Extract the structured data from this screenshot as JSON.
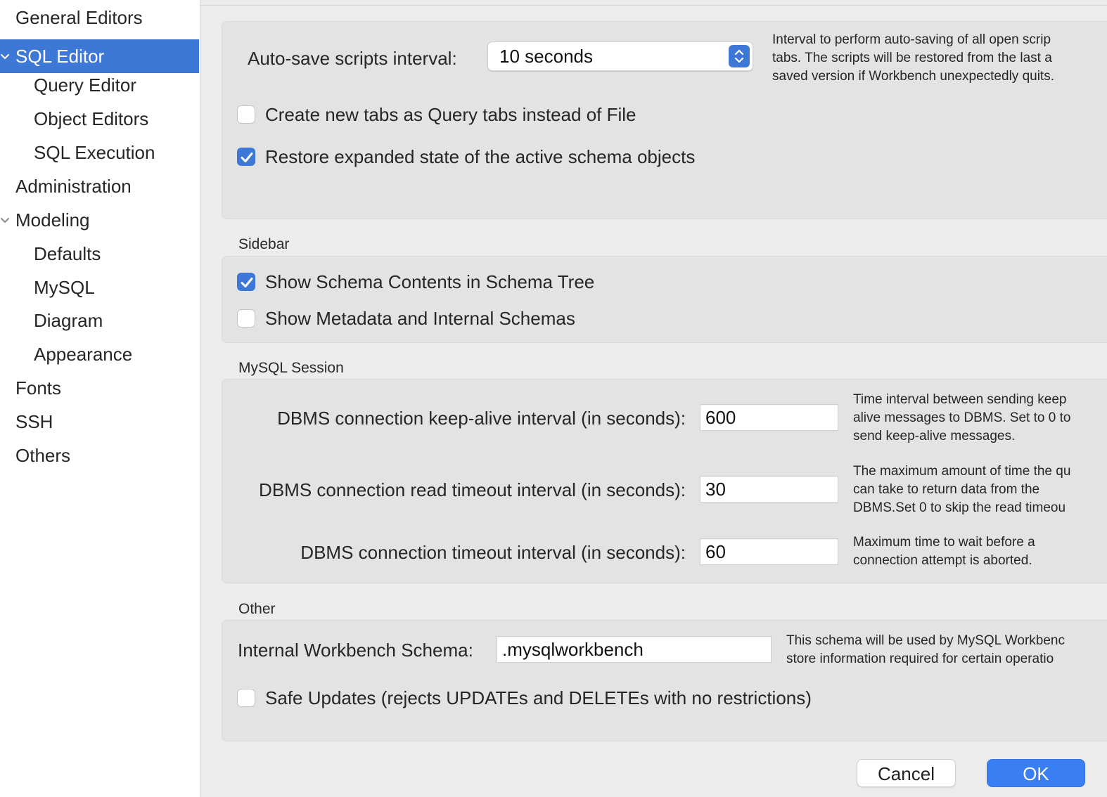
{
  "sidebar": {
    "items": [
      {
        "label": "General Editors"
      },
      {
        "label": "SQL Editor"
      },
      {
        "label": "Query Editor"
      },
      {
        "label": "Object Editors"
      },
      {
        "label": "SQL Execution"
      },
      {
        "label": "Administration"
      },
      {
        "label": "Modeling"
      },
      {
        "label": "Defaults"
      },
      {
        "label": "MySQL"
      },
      {
        "label": "Diagram"
      },
      {
        "label": "Appearance"
      },
      {
        "label": "Fonts"
      },
      {
        "label": "SSH"
      },
      {
        "label": "Others"
      }
    ],
    "selected": "SQL Editor",
    "accent_color": "#3e78d6"
  },
  "general": {
    "autosave_label": "Auto-save scripts interval:",
    "autosave_value": "10 seconds",
    "autosave_help": [
      "Interval to perform auto-saving of all open scrip",
      "tabs. The scripts will be restored from the last a",
      "saved version if Workbench unexpectedly quits."
    ],
    "create_tabs_label": "Create new tabs as Query tabs instead of File",
    "create_tabs_checked": false,
    "restore_state_label": "Restore expanded state of the active schema objects",
    "restore_state_checked": true
  },
  "sidebar_section": {
    "title": "Sidebar",
    "show_schema_label": "Show Schema Contents in Schema Tree",
    "show_schema_checked": true,
    "show_metadata_label": "Show Metadata and Internal Schemas",
    "show_metadata_checked": false
  },
  "session": {
    "title": "MySQL Session",
    "keepalive_label": "DBMS connection keep-alive interval (in seconds):",
    "keepalive_value": "600",
    "keepalive_help": [
      "Time interval between sending keep",
      "alive messages to DBMS. Set to 0 to",
      "send keep-alive messages."
    ],
    "read_timeout_label": "DBMS connection read timeout interval (in seconds):",
    "read_timeout_value": "30",
    "read_timeout_help": [
      "The maximum amount of time the qu",
      "can take to return data from the",
      "DBMS.Set 0 to skip the read timeou"
    ],
    "conn_timeout_label": "DBMS connection timeout interval (in seconds):",
    "conn_timeout_value": "60",
    "conn_timeout_help": [
      "Maximum time to wait before a",
      "connection attempt is aborted."
    ]
  },
  "other": {
    "title": "Other",
    "schema_label": "Internal Workbench Schema:",
    "schema_value": ".mysqlworkbench",
    "schema_help": [
      "This schema will be used by MySQL Workbenc",
      "store information required for certain operatio"
    ],
    "safe_updates_label": "Safe Updates (rejects UPDATEs and DELETEs with no restrictions)",
    "safe_updates_checked": false
  },
  "buttons": {
    "cancel": "Cancel",
    "ok": "OK"
  }
}
